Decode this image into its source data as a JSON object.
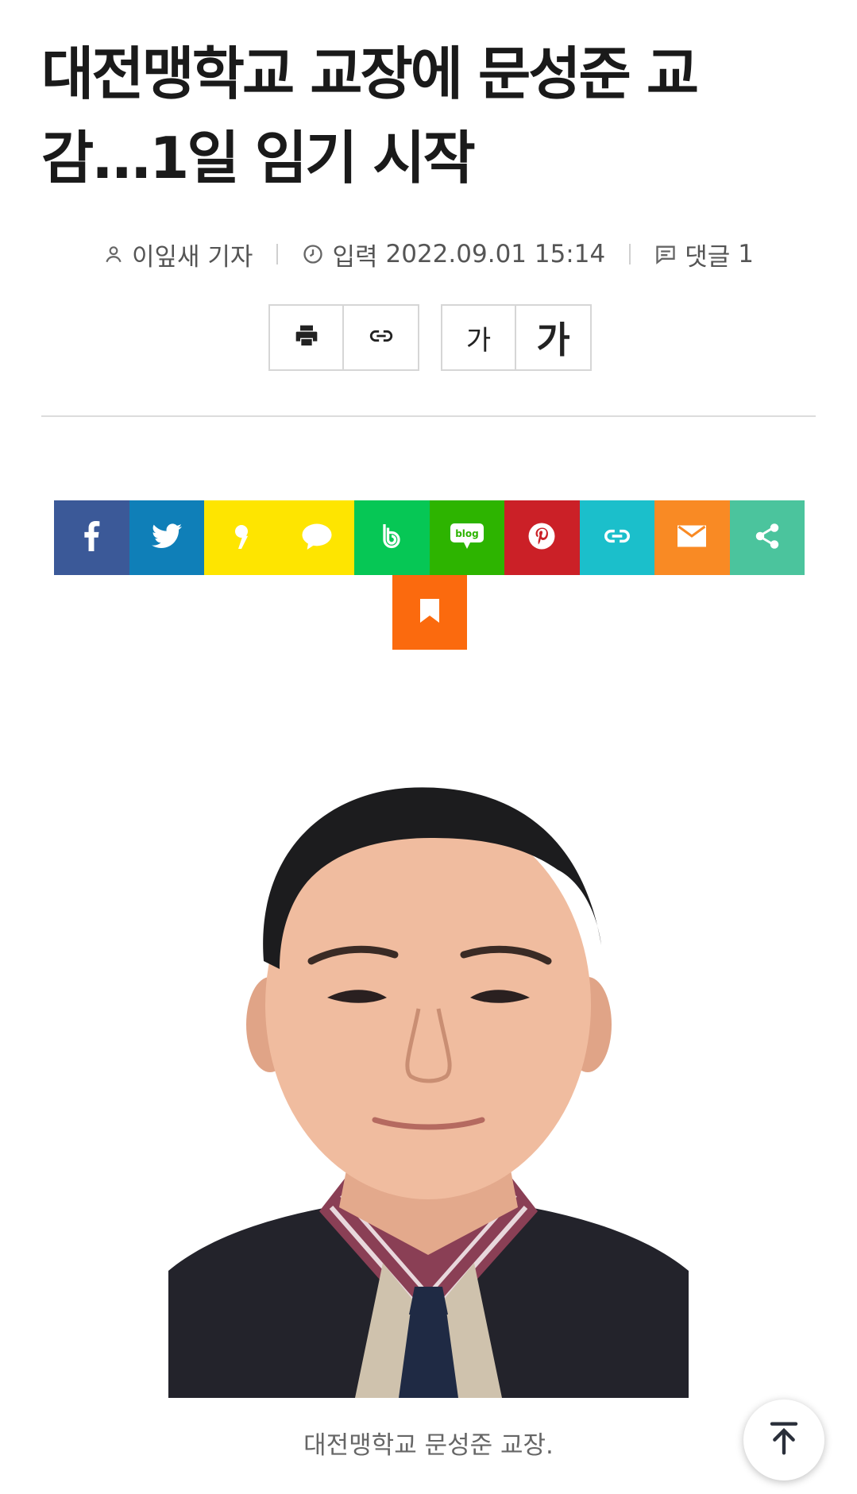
{
  "article": {
    "title_line1": "대전맹학교 교장에 문성준 교",
    "title_line2": "감...1일 임기 시작",
    "reporter": "이잎새 기자",
    "published_label": "입력",
    "published_at": "2022.09.01 15:14",
    "comments_label": "댓글",
    "comments_count": "1"
  },
  "tools": {
    "font_small_label": "가",
    "font_large_label": "가"
  },
  "share": [
    {
      "name": "facebook",
      "color": "#3b5998",
      "icon": "facebook-icon"
    },
    {
      "name": "twitter",
      "color": "#0f7fb8",
      "icon": "twitter-icon"
    },
    {
      "name": "kakaostory",
      "color": "#fee500",
      "icon": "kakaostory-icon"
    },
    {
      "name": "kakaotalk",
      "color": "#fee500",
      "icon": "kakaotalk-icon"
    },
    {
      "name": "band",
      "color": "#06c755",
      "icon": "band-icon"
    },
    {
      "name": "naver-blog",
      "color": "#2db400",
      "icon": "naver-blog-icon",
      "label": "blog"
    },
    {
      "name": "pinterest",
      "color": "#cb2027",
      "icon": "pinterest-icon"
    },
    {
      "name": "link",
      "color": "#1bbfcb",
      "icon": "link-icon"
    },
    {
      "name": "email",
      "color": "#f98a24",
      "icon": "email-icon"
    },
    {
      "name": "share",
      "color": "#4bc49d",
      "icon": "share-icon"
    },
    {
      "name": "bookmark",
      "color": "#fb6a0e",
      "icon": "bookmark-icon"
    }
  ],
  "photo": {
    "caption": "대전맹학교 문성준 교장."
  },
  "back_to_top": {
    "icon": "arrow-up-to-top-icon"
  }
}
